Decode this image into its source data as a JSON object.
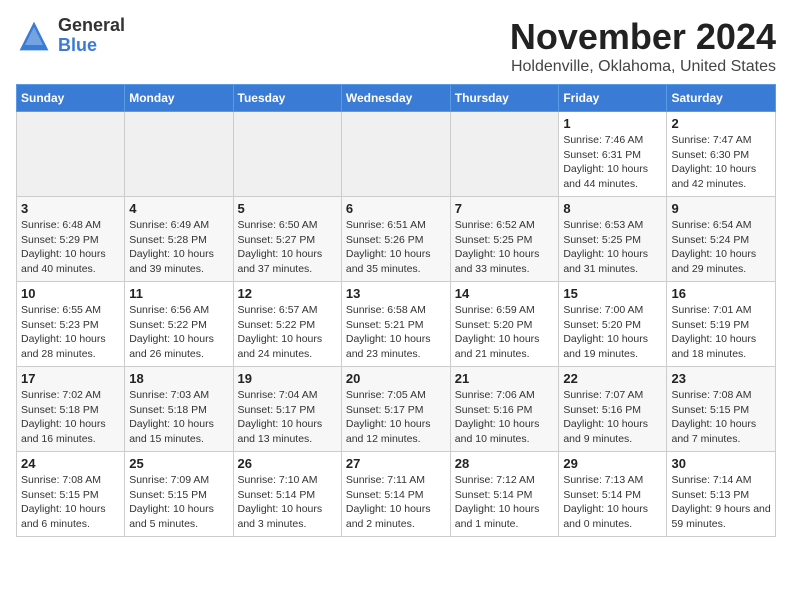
{
  "app": {
    "name": "GeneralBlue",
    "logo_text_general": "General",
    "logo_text_blue": "Blue"
  },
  "calendar": {
    "month": "November 2024",
    "location": "Holdenville, Oklahoma, United States",
    "days_of_week": [
      "Sunday",
      "Monday",
      "Tuesday",
      "Wednesday",
      "Thursday",
      "Friday",
      "Saturday"
    ],
    "weeks": [
      [
        {
          "day": "",
          "info": ""
        },
        {
          "day": "",
          "info": ""
        },
        {
          "day": "",
          "info": ""
        },
        {
          "day": "",
          "info": ""
        },
        {
          "day": "",
          "info": ""
        },
        {
          "day": "1",
          "info": "Sunrise: 7:46 AM\nSunset: 6:31 PM\nDaylight: 10 hours and 44 minutes."
        },
        {
          "day": "2",
          "info": "Sunrise: 7:47 AM\nSunset: 6:30 PM\nDaylight: 10 hours and 42 minutes."
        }
      ],
      [
        {
          "day": "3",
          "info": "Sunrise: 6:48 AM\nSunset: 5:29 PM\nDaylight: 10 hours and 40 minutes."
        },
        {
          "day": "4",
          "info": "Sunrise: 6:49 AM\nSunset: 5:28 PM\nDaylight: 10 hours and 39 minutes."
        },
        {
          "day": "5",
          "info": "Sunrise: 6:50 AM\nSunset: 5:27 PM\nDaylight: 10 hours and 37 minutes."
        },
        {
          "day": "6",
          "info": "Sunrise: 6:51 AM\nSunset: 5:26 PM\nDaylight: 10 hours and 35 minutes."
        },
        {
          "day": "7",
          "info": "Sunrise: 6:52 AM\nSunset: 5:25 PM\nDaylight: 10 hours and 33 minutes."
        },
        {
          "day": "8",
          "info": "Sunrise: 6:53 AM\nSunset: 5:25 PM\nDaylight: 10 hours and 31 minutes."
        },
        {
          "day": "9",
          "info": "Sunrise: 6:54 AM\nSunset: 5:24 PM\nDaylight: 10 hours and 29 minutes."
        }
      ],
      [
        {
          "day": "10",
          "info": "Sunrise: 6:55 AM\nSunset: 5:23 PM\nDaylight: 10 hours and 28 minutes."
        },
        {
          "day": "11",
          "info": "Sunrise: 6:56 AM\nSunset: 5:22 PM\nDaylight: 10 hours and 26 minutes."
        },
        {
          "day": "12",
          "info": "Sunrise: 6:57 AM\nSunset: 5:22 PM\nDaylight: 10 hours and 24 minutes."
        },
        {
          "day": "13",
          "info": "Sunrise: 6:58 AM\nSunset: 5:21 PM\nDaylight: 10 hours and 23 minutes."
        },
        {
          "day": "14",
          "info": "Sunrise: 6:59 AM\nSunset: 5:20 PM\nDaylight: 10 hours and 21 minutes."
        },
        {
          "day": "15",
          "info": "Sunrise: 7:00 AM\nSunset: 5:20 PM\nDaylight: 10 hours and 19 minutes."
        },
        {
          "day": "16",
          "info": "Sunrise: 7:01 AM\nSunset: 5:19 PM\nDaylight: 10 hours and 18 minutes."
        }
      ],
      [
        {
          "day": "17",
          "info": "Sunrise: 7:02 AM\nSunset: 5:18 PM\nDaylight: 10 hours and 16 minutes."
        },
        {
          "day": "18",
          "info": "Sunrise: 7:03 AM\nSunset: 5:18 PM\nDaylight: 10 hours and 15 minutes."
        },
        {
          "day": "19",
          "info": "Sunrise: 7:04 AM\nSunset: 5:17 PM\nDaylight: 10 hours and 13 minutes."
        },
        {
          "day": "20",
          "info": "Sunrise: 7:05 AM\nSunset: 5:17 PM\nDaylight: 10 hours and 12 minutes."
        },
        {
          "day": "21",
          "info": "Sunrise: 7:06 AM\nSunset: 5:16 PM\nDaylight: 10 hours and 10 minutes."
        },
        {
          "day": "22",
          "info": "Sunrise: 7:07 AM\nSunset: 5:16 PM\nDaylight: 10 hours and 9 minutes."
        },
        {
          "day": "23",
          "info": "Sunrise: 7:08 AM\nSunset: 5:15 PM\nDaylight: 10 hours and 7 minutes."
        }
      ],
      [
        {
          "day": "24",
          "info": "Sunrise: 7:08 AM\nSunset: 5:15 PM\nDaylight: 10 hours and 6 minutes."
        },
        {
          "day": "25",
          "info": "Sunrise: 7:09 AM\nSunset: 5:15 PM\nDaylight: 10 hours and 5 minutes."
        },
        {
          "day": "26",
          "info": "Sunrise: 7:10 AM\nSunset: 5:14 PM\nDaylight: 10 hours and 3 minutes."
        },
        {
          "day": "27",
          "info": "Sunrise: 7:11 AM\nSunset: 5:14 PM\nDaylight: 10 hours and 2 minutes."
        },
        {
          "day": "28",
          "info": "Sunrise: 7:12 AM\nSunset: 5:14 PM\nDaylight: 10 hours and 1 minute."
        },
        {
          "day": "29",
          "info": "Sunrise: 7:13 AM\nSunset: 5:14 PM\nDaylight: 10 hours and 0 minutes."
        },
        {
          "day": "30",
          "info": "Sunrise: 7:14 AM\nSunset: 5:13 PM\nDaylight: 9 hours and 59 minutes."
        }
      ]
    ]
  }
}
